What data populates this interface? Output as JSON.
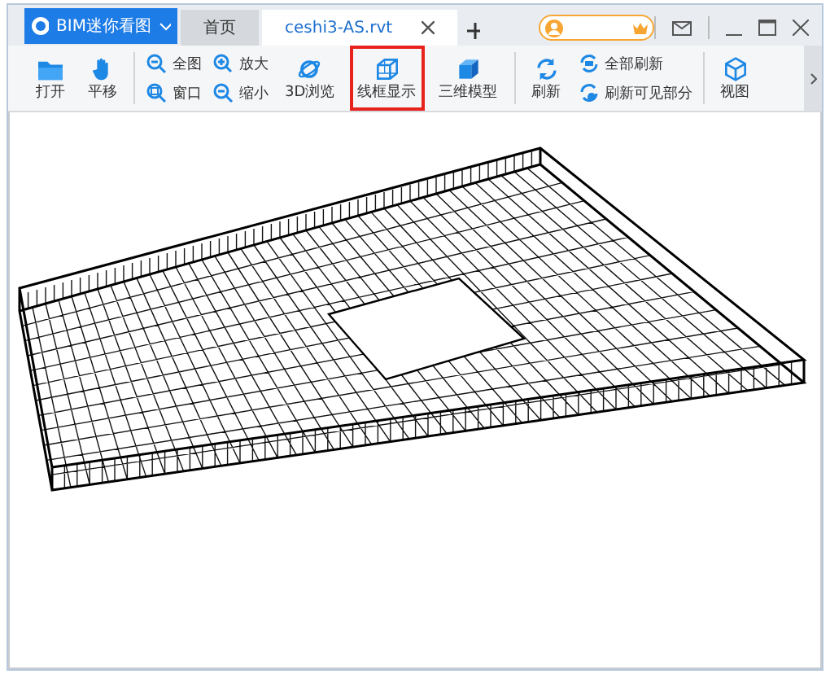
{
  "app_menu": {
    "label": "BIM迷你看图"
  },
  "tabs": [
    {
      "label": "首页",
      "selected": false
    },
    {
      "label": "ceshi3-AS.rvt",
      "selected": true
    }
  ],
  "toolbar": [
    {
      "kind": "large",
      "label": "打开",
      "highlighted": false
    },
    {
      "kind": "large",
      "label": "平移",
      "highlighted": false
    },
    {
      "kind": "stack",
      "items": [
        "全图",
        "窗口"
      ]
    },
    {
      "kind": "stack",
      "items": [
        "放大",
        "缩小"
      ]
    },
    {
      "kind": "large",
      "label": "3D浏览",
      "highlighted": false
    },
    {
      "kind": "large",
      "label": "线框显示",
      "highlighted": true
    },
    {
      "kind": "large",
      "label": "三维模型",
      "highlighted": false
    },
    {
      "kind": "large",
      "label": "刷新",
      "highlighted": false
    },
    {
      "kind": "stack",
      "items": [
        "全部刷新",
        "刷新可见部分"
      ]
    },
    {
      "kind": "large",
      "label": "视图",
      "highlighted": false
    }
  ]
}
